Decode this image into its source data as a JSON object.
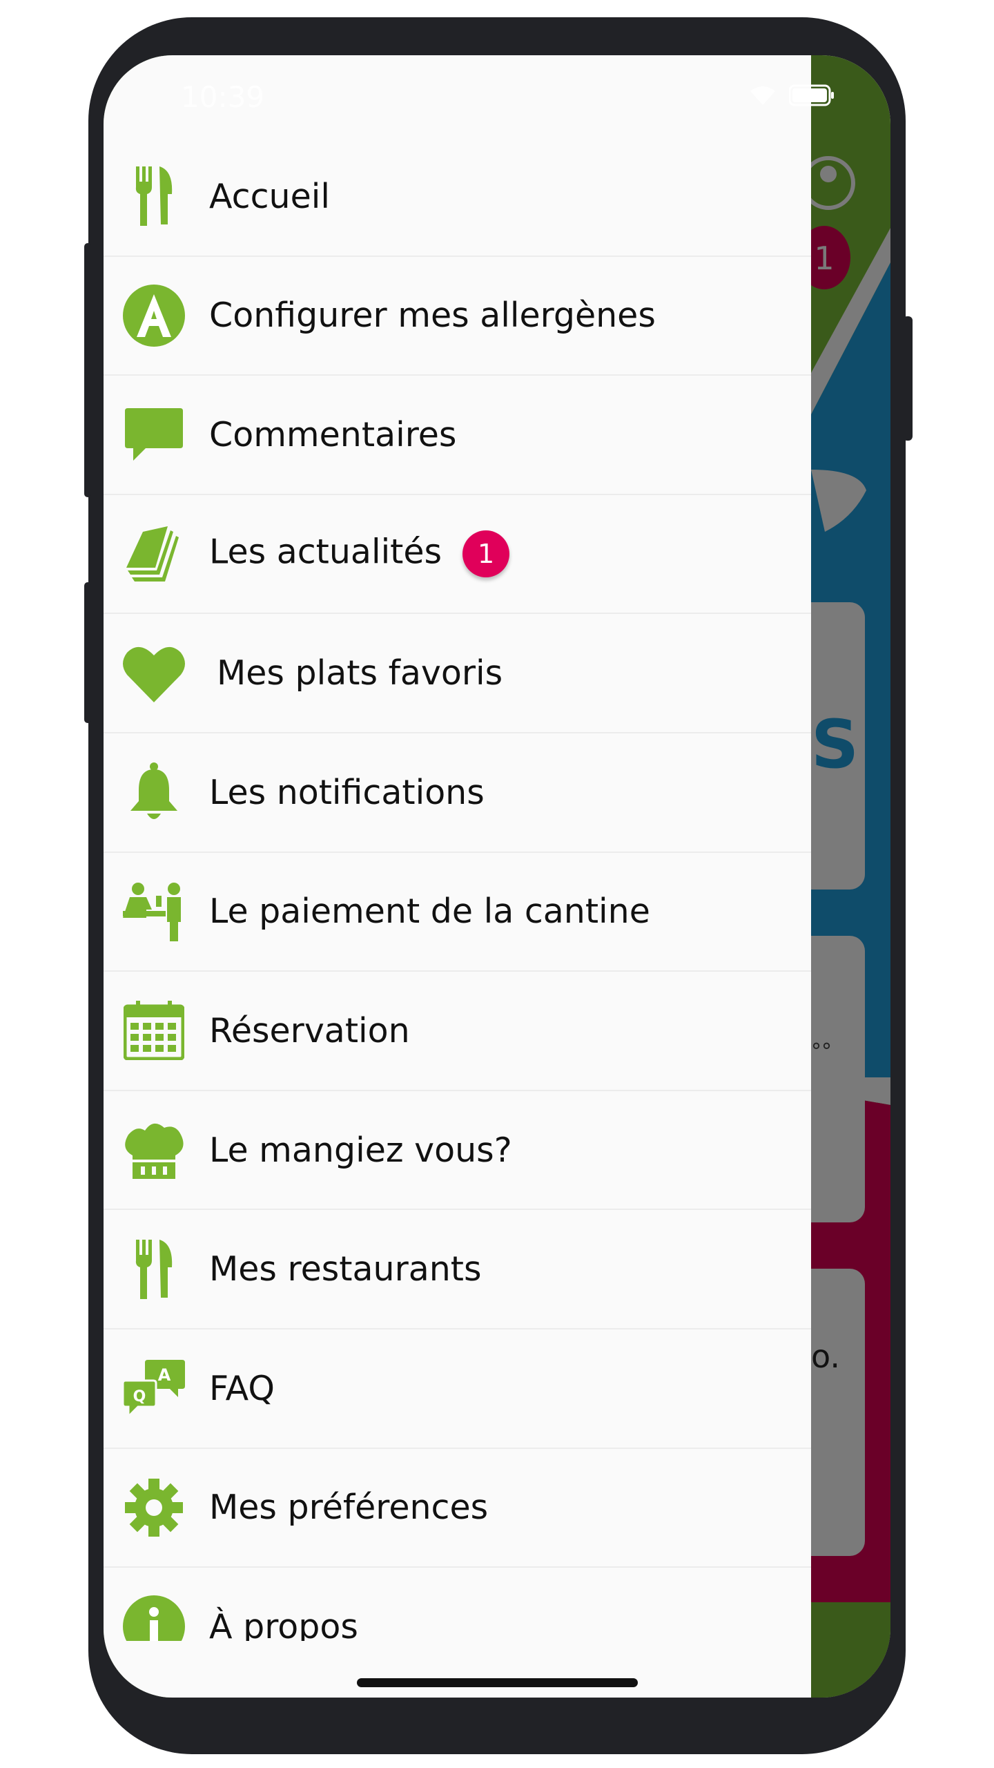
{
  "status_bar": {
    "time": "10:39"
  },
  "background": {
    "header_badge": "1",
    "card_text_1": "S",
    "card_text_2": "°°",
    "card_text_3": "o."
  },
  "colors": {
    "accent": "#7ab62f",
    "badge": "#e0005a",
    "frame": "#212226",
    "header": "#3a5a1a",
    "blue": "#0f4c6a",
    "maroon": "#6a0028"
  },
  "menu": {
    "items": [
      {
        "label": "Accueil",
        "icon": "fork-knife-icon"
      },
      {
        "label": "Configurer mes allergènes",
        "icon": "allergen-a-icon"
      },
      {
        "label": "Commentaires",
        "icon": "comment-icon"
      },
      {
        "label": "Les actualités",
        "icon": "newspaper-icon",
        "badge": "1"
      },
      {
        "label": "Mes plats favoris",
        "icon": "heart-icon"
      },
      {
        "label": "Les notifications",
        "icon": "bell-icon"
      },
      {
        "label": "Le paiement de la cantine",
        "icon": "payment-people-icon"
      },
      {
        "label": "Réservation",
        "icon": "calendar-icon"
      },
      {
        "label": "Le mangiez vous?",
        "icon": "chef-hat-icon"
      },
      {
        "label": "Mes restaurants",
        "icon": "fork-knife-icon"
      },
      {
        "label": "FAQ",
        "icon": "faq-icon"
      },
      {
        "label": "Mes préférences",
        "icon": "gear-icon"
      },
      {
        "label": "À propos",
        "icon": "info-icon"
      }
    ]
  }
}
